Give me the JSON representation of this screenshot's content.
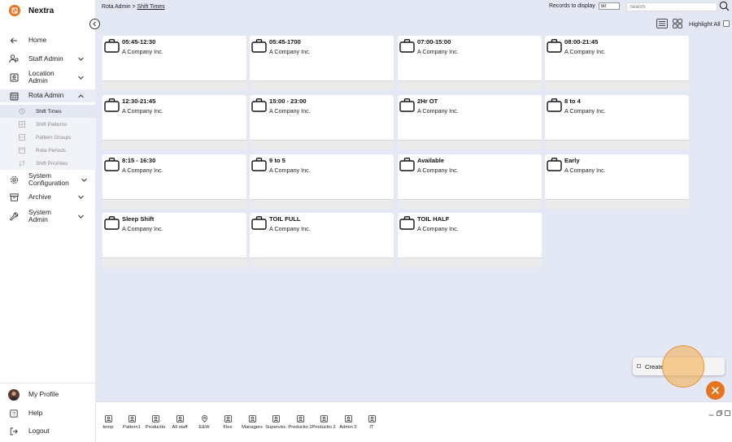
{
  "brand": {
    "name": "Nextra",
    "color": "#e8731e"
  },
  "nav": {
    "home": "Home",
    "staff_admin": "Staff Admin",
    "location_admin": "Location Admin",
    "rota_admin": "Rota Admin",
    "system_configuration": "System Configuration",
    "archive": "Archive",
    "system_admin": "System Admin",
    "sub_items": [
      "Shift Times",
      "Shift Patterns",
      "Pattern Groups",
      "Rota Periods",
      "Shift Priorities"
    ]
  },
  "bottom_nav": {
    "my_profile": "My Profile",
    "help": "Help",
    "logout": "Logout"
  },
  "header": {
    "breadcrumb_root": "Rota Admin > ",
    "breadcrumb_current": "Shift Times",
    "records_label": "Records to display",
    "records_value": "50",
    "search_placeholder": "Search",
    "highlight_all": "Highlight All"
  },
  "cards": [
    {
      "title": "05:45-12:30",
      "company": "A Company Inc."
    },
    {
      "title": "05:45-1700",
      "company": "A Company Inc."
    },
    {
      "title": "07:00-15:00",
      "company": "A Company Inc."
    },
    {
      "title": "08:00-21:45",
      "company": "A Company Inc."
    },
    {
      "title": "12:30-21:45",
      "company": "A Company Inc."
    },
    {
      "title": "15:00 - 23:00",
      "company": "A Company Inc."
    },
    {
      "title": "2Hr OT",
      "company": "A Company Inc."
    },
    {
      "title": "8 to 4",
      "company": "A Company Inc."
    },
    {
      "title": "8:15 - 16:30",
      "company": "A Company Inc."
    },
    {
      "title": "9 to 5",
      "company": "A Company Inc."
    },
    {
      "title": "Available",
      "company": "A Company Inc."
    },
    {
      "title": "Early",
      "company": "A Company Inc."
    },
    {
      "title": "Sleep Shift",
      "company": "A Company Inc."
    },
    {
      "title": "TOIL FULL",
      "company": "A Company Inc."
    },
    {
      "title": "TOIL HALF",
      "company": "A Company Inc."
    }
  ],
  "create_label": "Create",
  "dock": [
    {
      "label": "temp",
      "icon": "person-icon"
    },
    {
      "label": "Pattern1",
      "icon": "person-icon"
    },
    {
      "label": "Productio",
      "icon": "person-icon"
    },
    {
      "label": "All staff",
      "icon": "person-icon"
    },
    {
      "label": "E&W",
      "icon": "location-pin-icon"
    },
    {
      "label": "Flex",
      "icon": "person-icon"
    },
    {
      "label": "Managers",
      "icon": "person-icon"
    },
    {
      "label": "Supervisc",
      "icon": "person-icon"
    },
    {
      "label": "Productio 1",
      "icon": "person-icon"
    },
    {
      "label": "Productio 2",
      "icon": "person-icon"
    },
    {
      "label": "Admin 2",
      "icon": "person-icon"
    },
    {
      "label": "IT",
      "icon": "person-icon"
    }
  ]
}
